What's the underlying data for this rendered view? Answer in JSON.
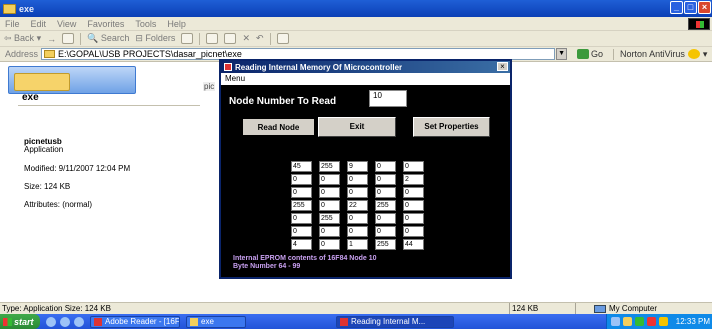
{
  "window": {
    "title": "exe",
    "controls": [
      "_",
      "□",
      "×"
    ]
  },
  "menu": [
    "File",
    "Edit",
    "View",
    "Favorites",
    "Tools",
    "Help"
  ],
  "toolbar": {
    "back": "Back",
    "forward": "→",
    "search": "Search",
    "folders": "Folders",
    "icons": [
      "up-folder-icon",
      "history-icon",
      "move-icon",
      "copy-icon",
      "delete-icon",
      "undo-icon",
      "views-icon"
    ]
  },
  "address": {
    "label": "Address",
    "value": "E:\\GOPAL\\USB PROJECTS\\dasar_picnet\\exe",
    "go": "Go",
    "norton": "Norton AntiVirus"
  },
  "left_pane": {
    "folder_name": "exe",
    "file_name": "picnetusb",
    "file_type": "Application",
    "modified": "Modified: 9/11/2007 12:04 PM",
    "size": "Size: 124 KB",
    "attributes": "Attributes: (normal)"
  },
  "partial_label": "pic",
  "dialog": {
    "title": "Reading Internal Memory Of Microcontroller",
    "menu": "Menu",
    "node_label": "Node Number To Read",
    "node_value": "10",
    "buttons": {
      "read": "Read Node",
      "exit": "Exit",
      "properties": "Set Properties"
    },
    "grid": [
      [
        "45",
        "255",
        "9",
        "0",
        "0"
      ],
      [
        "0",
        "0",
        "0",
        "0",
        "2"
      ],
      [
        "0",
        "0",
        "0",
        "0",
        "0"
      ],
      [
        "255",
        "0",
        "22",
        "255",
        "0"
      ],
      [
        "0",
        "255",
        "0",
        "0",
        "0"
      ],
      [
        "0",
        "0",
        "0",
        "0",
        "0"
      ],
      [
        "4",
        "0",
        "1",
        "255",
        "44"
      ]
    ],
    "footer_line1": "Internal EPROM contents of 16F84 Node  10",
    "footer_line2": "Byte Number 64 - 99"
  },
  "status": {
    "left": "Type: Application Size: 124 KB",
    "size": "124 KB",
    "zone": "My Computer"
  },
  "taskbar": {
    "start": "start",
    "tasks": [
      "Adobe Reader - [16F84...",
      "exe",
      "Reading Internal M..."
    ],
    "clock": "12:33 PM"
  },
  "colors": {
    "title_blue": "#0b3fb5",
    "dialog_bg": "#000000",
    "footer_text": "#c8a0f0",
    "taskbar": "#2153d8"
  }
}
